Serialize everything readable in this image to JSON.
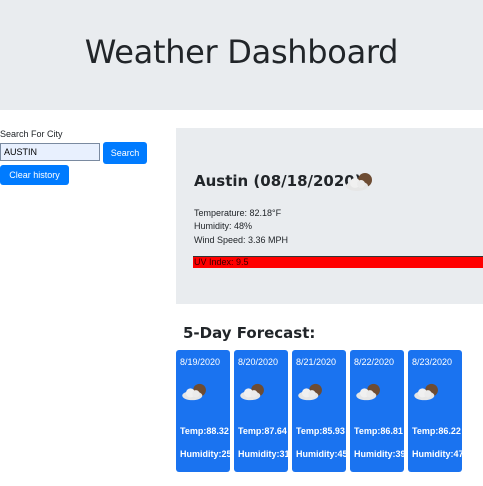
{
  "header": {
    "title": "Weather Dashboard"
  },
  "search": {
    "label": "Search For City",
    "value": "AUSTIN",
    "search_button": "Search",
    "clear_button": "Clear history"
  },
  "current": {
    "title": "Austin (08/18/2020)",
    "icon": "partly-cloudy-icon",
    "temperature": "Temperature: 82.18°F",
    "humidity": "Humidity: 48%",
    "wind": "Wind Speed: 3.36 MPH",
    "uv": "UV Index: 9.5",
    "uv_color": "#ff0000"
  },
  "forecast": {
    "title": "5-Day Forecast:",
    "card_color": "#1a73f0",
    "days": [
      {
        "date": "8/19/2020",
        "icon": "partly-cloudy-icon",
        "temp": "Temp:88.32",
        "humidity": "Humidity:25"
      },
      {
        "date": "8/20/2020",
        "icon": "partly-cloudy-icon",
        "temp": "Temp:87.64",
        "humidity": "Humidity:31"
      },
      {
        "date": "8/21/2020",
        "icon": "partly-cloudy-icon",
        "temp": "Temp:85.93",
        "humidity": "Humidity:45"
      },
      {
        "date": "8/22/2020",
        "icon": "partly-cloudy-icon",
        "temp": "Temp:86.81",
        "humidity": "Humidity:39"
      },
      {
        "date": "8/23/2020",
        "icon": "partly-cloudy-icon",
        "temp": "Temp:86.22",
        "humidity": "Humidity:47"
      }
    ]
  }
}
